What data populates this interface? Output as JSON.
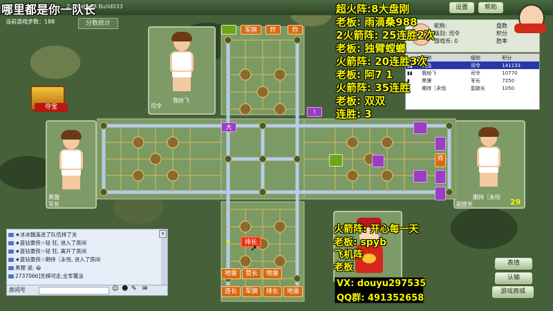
{
  "window": {
    "title": "哪里都是你一队长",
    "version": "2.1 Beta08 Build033",
    "steps_label": "当前游戏步数：188",
    "stats_button": "分数统计",
    "top_buttons": [
      "设置",
      "帮助"
    ]
  },
  "players": {
    "top": {
      "name": "我纷飞",
      "rank": "司令"
    },
    "left": {
      "name": "黑狸",
      "rank": "军长"
    },
    "right": {
      "name": "期待〖永恒",
      "rank": "副旅长",
      "count": "29"
    }
  },
  "treasure_label": "夺宝",
  "player_info": {
    "nick_label": "昵称:",
    "level_label": "级别: 司令",
    "coin_label": "游戏币: 0",
    "score_label": "积分:",
    "win_label": "胜率",
    "extra1": "盘数",
    "extra2": "积分",
    "extra3": "胜率"
  },
  "ranking_table": {
    "headers": [
      "",
      "昵称",
      "级别",
      "积分"
    ],
    "rows": [
      {
        "name": "九品",
        "level": "司令",
        "score": "141133",
        "selected": true
      },
      {
        "name": "我纷飞",
        "level": "司令",
        "score": "10770",
        "selected": false
      },
      {
        "name": "黑狸",
        "level": "军长",
        "score": "7250",
        "selected": false
      },
      {
        "name": "期待〖永恒",
        "level": "副旅长",
        "score": "1050",
        "selected": false
      }
    ]
  },
  "overlay_stream": {
    "lines": [
      "超火阵:8大盘刚",
      "老板: 雨滴桑988",
      "2火箭阵: 25连胜2次",
      "老板: 独臂螳螂",
      "火箭阵: 20连胜3次",
      "老板: 阿7 1",
      "火箭阵: 35连胜",
      "老板: 双双",
      "连胜: 3"
    ],
    "lower_lines": [
      "火箭阵: 开心每一天",
      "老板: spyb",
      "飞机阵",
      "老板"
    ],
    "vx": "VX: douyu297535",
    "qq": "QQ群: 491352658"
  },
  "board_pieces": {
    "top_row": [
      "军旗",
      "炸",
      "炸"
    ],
    "left_piece": "大",
    "right_top_bang": "!",
    "right_col": [
      "师"
    ],
    "bottom_active": "排长",
    "bottom_row1": [
      "地雷",
      "营长",
      "地雷"
    ],
    "bottom_row2": [
      "连长",
      "军旗",
      "排长",
      "地雷"
    ]
  },
  "chat": {
    "lines": [
      "★冰冰魏溪进了队伍排了关",
      "★蓝钻豪侠☆轻 狂, 进入了房间",
      "★蓝钻豪侠☆轻 狂, 离开了房间",
      "★蓝钻豪侠☆期待〖永恒, 进入了房间",
      "黑狸 说: 😀",
      "2737066]无棋可走,全军覆没"
    ],
    "room_label": "房间号",
    "speaker": "黑狸"
  },
  "right_buttons": [
    "表情",
    "认输",
    "游戏商城"
  ],
  "colors": {
    "overlay_text": "#f6f600",
    "promo_bg": "#000000",
    "piece_orange": "#d66b12",
    "piece_purple": "#9a3fbf",
    "piece_green": "#6fa41d"
  }
}
